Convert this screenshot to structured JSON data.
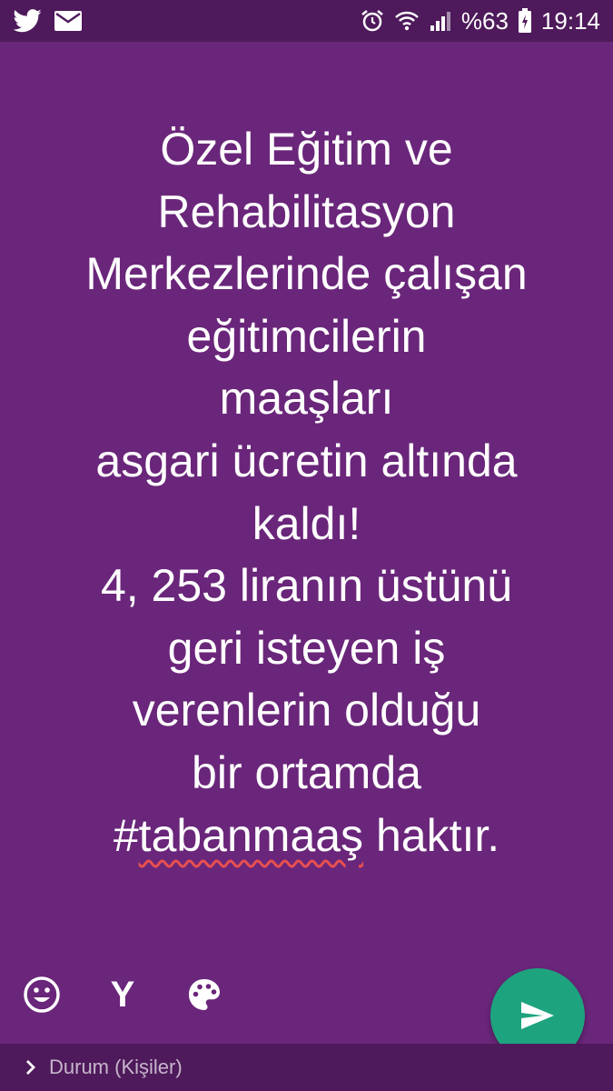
{
  "status_bar": {
    "battery": "%63",
    "time": "19:14",
    "icons": [
      "twitter-icon",
      "mail-icon",
      "alarm-icon",
      "wifi-icon",
      "signal-icon",
      "battery-charging-icon"
    ]
  },
  "status_text": {
    "lines": [
      "Özel Eğitim ve",
      "Rehabilitasyon",
      "Merkezlerinde çalışan",
      "eğitimcilerin",
      "maaşları",
      "asgari ücretin altında",
      "kaldı!",
      "4, 253 liranın üstünü",
      "geri isteyen iş",
      "verenlerin olduğu",
      "bir ortamda"
    ],
    "last_line_prefix": "#",
    "hashtag_word": "tabanmaaş",
    "last_line_suffix": " haktır."
  },
  "toolbar": {
    "font_label": "Y",
    "icons": [
      "emoji-icon",
      "font-icon",
      "palette-icon"
    ]
  },
  "send_button": {
    "icon": "send-icon"
  },
  "bottom_bar": {
    "audience_label": "Durum (Kişiler)"
  },
  "colors": {
    "background": "#6a267a",
    "status_bar": "#4e1a5b",
    "send_button": "#1ea37f",
    "spellcheck_underline": "#e8504f"
  }
}
